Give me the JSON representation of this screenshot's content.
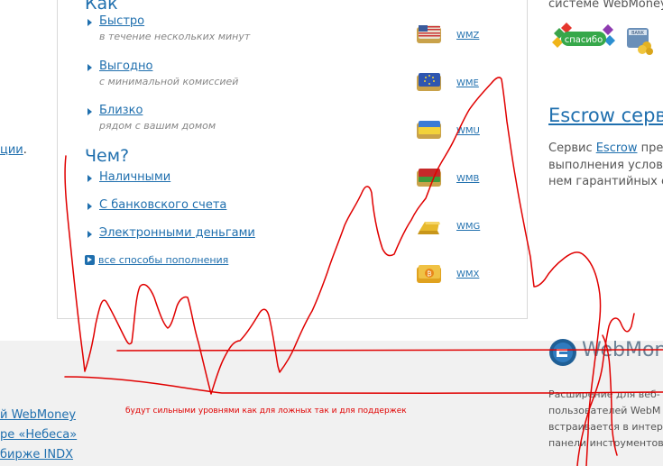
{
  "how": {
    "title": "Как",
    "items": [
      {
        "label": "Быстро",
        "sub": "в течение нескольких минут"
      },
      {
        "label": "Выгодно",
        "sub": "с минимальной комиссией"
      },
      {
        "label": "Близко",
        "sub": "рядом с вашим домом"
      }
    ]
  },
  "with_what": {
    "title": "Чем?",
    "items": [
      "Наличными",
      "С банковского счета",
      "Электронными деньгами"
    ],
    "all_methods": "все способы пополнения"
  },
  "currencies": [
    "WMZ",
    "WME",
    "WMU",
    "WMB",
    "WMG",
    "WMX"
  ],
  "right": {
    "top_text": "системе WebMoney",
    "escrow_title": "Escrow серв",
    "escrow_prefix": "Сервис ",
    "escrow_link": "Escrow",
    "escrow_suffix": " пред",
    "escrow_line2": "выполнения услови",
    "escrow_line3": "нем гарантийных сч",
    "webmoney_logo": "WebMoney",
    "ext_line1": "Расширение для веб-",
    "ext_line2": "пользователей WebM",
    "ext_line3": "встраивается в интер",
    "ext_line4": "панели инструментов"
  },
  "left": {
    "fragment": "ции",
    "fragment_tail": ".",
    "links": [
      "й WebMoney",
      "ре «Небеса»",
      "бирже INDX"
    ]
  },
  "annotation": "будут сильными уровнями как для ложных так и для поддержек",
  "colors": {
    "accent": "#1f6fae",
    "annotation": "#e00000"
  }
}
